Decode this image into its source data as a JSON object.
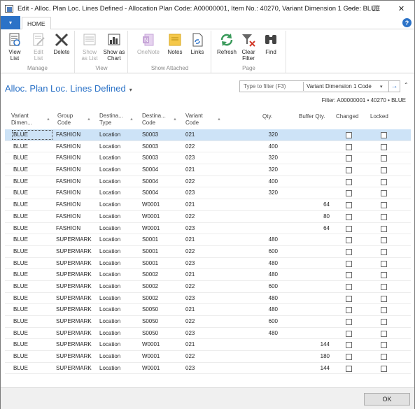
{
  "window": {
    "title": "Edit - Alloc. Plan Loc. Lines Defined - Allocation Plan Code: A00000001, Item No.: 40270, Variant Dimension 1 Code: BLUE",
    "minimize": "—",
    "maximize": "☐",
    "close": "✕"
  },
  "ribbon": {
    "app_menu_glyph": "▾",
    "tab": "HOME",
    "help_glyph": "?",
    "groups": {
      "manage": "Manage",
      "view": "View",
      "show_attached": "Show Attached",
      "page": "Page"
    },
    "buttons": {
      "view_list": "View List",
      "edit_list": "Edit List",
      "delete": "Delete",
      "show_as_list": "Show as List",
      "show_as_chart": "Show as Chart",
      "onenote": "OneNote",
      "notes": "Notes",
      "links": "Links",
      "refresh": "Refresh",
      "clear_filter": "Clear Filter",
      "find": "Find"
    }
  },
  "page": {
    "title": "Alloc. Plan Loc. Lines Defined",
    "title_caret": "▾",
    "filter_placeholder": "Type to filter (F3)",
    "filter_field": "Variant Dimension 1 Code",
    "filter_dropdown": "▾",
    "filter_go": "→",
    "collapse": "⌃",
    "filter_summary": "Filter: A00000001 • 40270 • BLUE"
  },
  "grid": {
    "columns": {
      "variant_dim": "Variant Dimen...",
      "group_code": "Group Code",
      "destination_type": "Destina... Type",
      "destination_code": "Destina... Code",
      "variant_code": "Variant Code",
      "qty": "Qty.",
      "buffer_qty": "Buffer Qty.",
      "changed": "Changed",
      "locked": "Locked"
    },
    "sort_glyph": "▲",
    "rows": [
      {
        "dim": "BLUE",
        "group": "FASHION",
        "type": "Location",
        "code": "S0003",
        "variant": "021",
        "qty": "320",
        "buffer": ""
      },
      {
        "dim": "BLUE",
        "group": "FASHION",
        "type": "Location",
        "code": "S0003",
        "variant": "022",
        "qty": "400",
        "buffer": ""
      },
      {
        "dim": "BLUE",
        "group": "FASHION",
        "type": "Location",
        "code": "S0003",
        "variant": "023",
        "qty": "320",
        "buffer": ""
      },
      {
        "dim": "BLUE",
        "group": "FASHION",
        "type": "Location",
        "code": "S0004",
        "variant": "021",
        "qty": "320",
        "buffer": ""
      },
      {
        "dim": "BLUE",
        "group": "FASHION",
        "type": "Location",
        "code": "S0004",
        "variant": "022",
        "qty": "400",
        "buffer": ""
      },
      {
        "dim": "BLUE",
        "group": "FASHION",
        "type": "Location",
        "code": "S0004",
        "variant": "023",
        "qty": "320",
        "buffer": ""
      },
      {
        "dim": "BLUE",
        "group": "FASHION",
        "type": "Location",
        "code": "W0001",
        "variant": "021",
        "qty": "",
        "buffer": "64"
      },
      {
        "dim": "BLUE",
        "group": "FASHION",
        "type": "Location",
        "code": "W0001",
        "variant": "022",
        "qty": "",
        "buffer": "80"
      },
      {
        "dim": "BLUE",
        "group": "FASHION",
        "type": "Location",
        "code": "W0001",
        "variant": "023",
        "qty": "",
        "buffer": "64"
      },
      {
        "dim": "BLUE",
        "group": "SUPERMARK",
        "type": "Location",
        "code": "S0001",
        "variant": "021",
        "qty": "480",
        "buffer": ""
      },
      {
        "dim": "BLUE",
        "group": "SUPERMARK",
        "type": "Location",
        "code": "S0001",
        "variant": "022",
        "qty": "600",
        "buffer": ""
      },
      {
        "dim": "BLUE",
        "group": "SUPERMARK",
        "type": "Location",
        "code": "S0001",
        "variant": "023",
        "qty": "480",
        "buffer": ""
      },
      {
        "dim": "BLUE",
        "group": "SUPERMARK",
        "type": "Location",
        "code": "S0002",
        "variant": "021",
        "qty": "480",
        "buffer": ""
      },
      {
        "dim": "BLUE",
        "group": "SUPERMARK",
        "type": "Location",
        "code": "S0002",
        "variant": "022",
        "qty": "600",
        "buffer": ""
      },
      {
        "dim": "BLUE",
        "group": "SUPERMARK",
        "type": "Location",
        "code": "S0002",
        "variant": "023",
        "qty": "480",
        "buffer": ""
      },
      {
        "dim": "BLUE",
        "group": "SUPERMARK",
        "type": "Location",
        "code": "S0050",
        "variant": "021",
        "qty": "480",
        "buffer": ""
      },
      {
        "dim": "BLUE",
        "group": "SUPERMARK",
        "type": "Location",
        "code": "S0050",
        "variant": "022",
        "qty": "600",
        "buffer": ""
      },
      {
        "dim": "BLUE",
        "group": "SUPERMARK",
        "type": "Location",
        "code": "S0050",
        "variant": "023",
        "qty": "480",
        "buffer": ""
      },
      {
        "dim": "BLUE",
        "group": "SUPERMARK",
        "type": "Location",
        "code": "W0001",
        "variant": "021",
        "qty": "",
        "buffer": "144"
      },
      {
        "dim": "BLUE",
        "group": "SUPERMARK",
        "type": "Location",
        "code": "W0001",
        "variant": "022",
        "qty": "",
        "buffer": "180"
      },
      {
        "dim": "BLUE",
        "group": "SUPERMARK",
        "type": "Location",
        "code": "W0001",
        "variant": "023",
        "qty": "",
        "buffer": "144"
      }
    ]
  },
  "footer": {
    "ok": "OK"
  },
  "colors": {
    "accent": "#2b72c7",
    "selected_row": "#cde3f7"
  }
}
